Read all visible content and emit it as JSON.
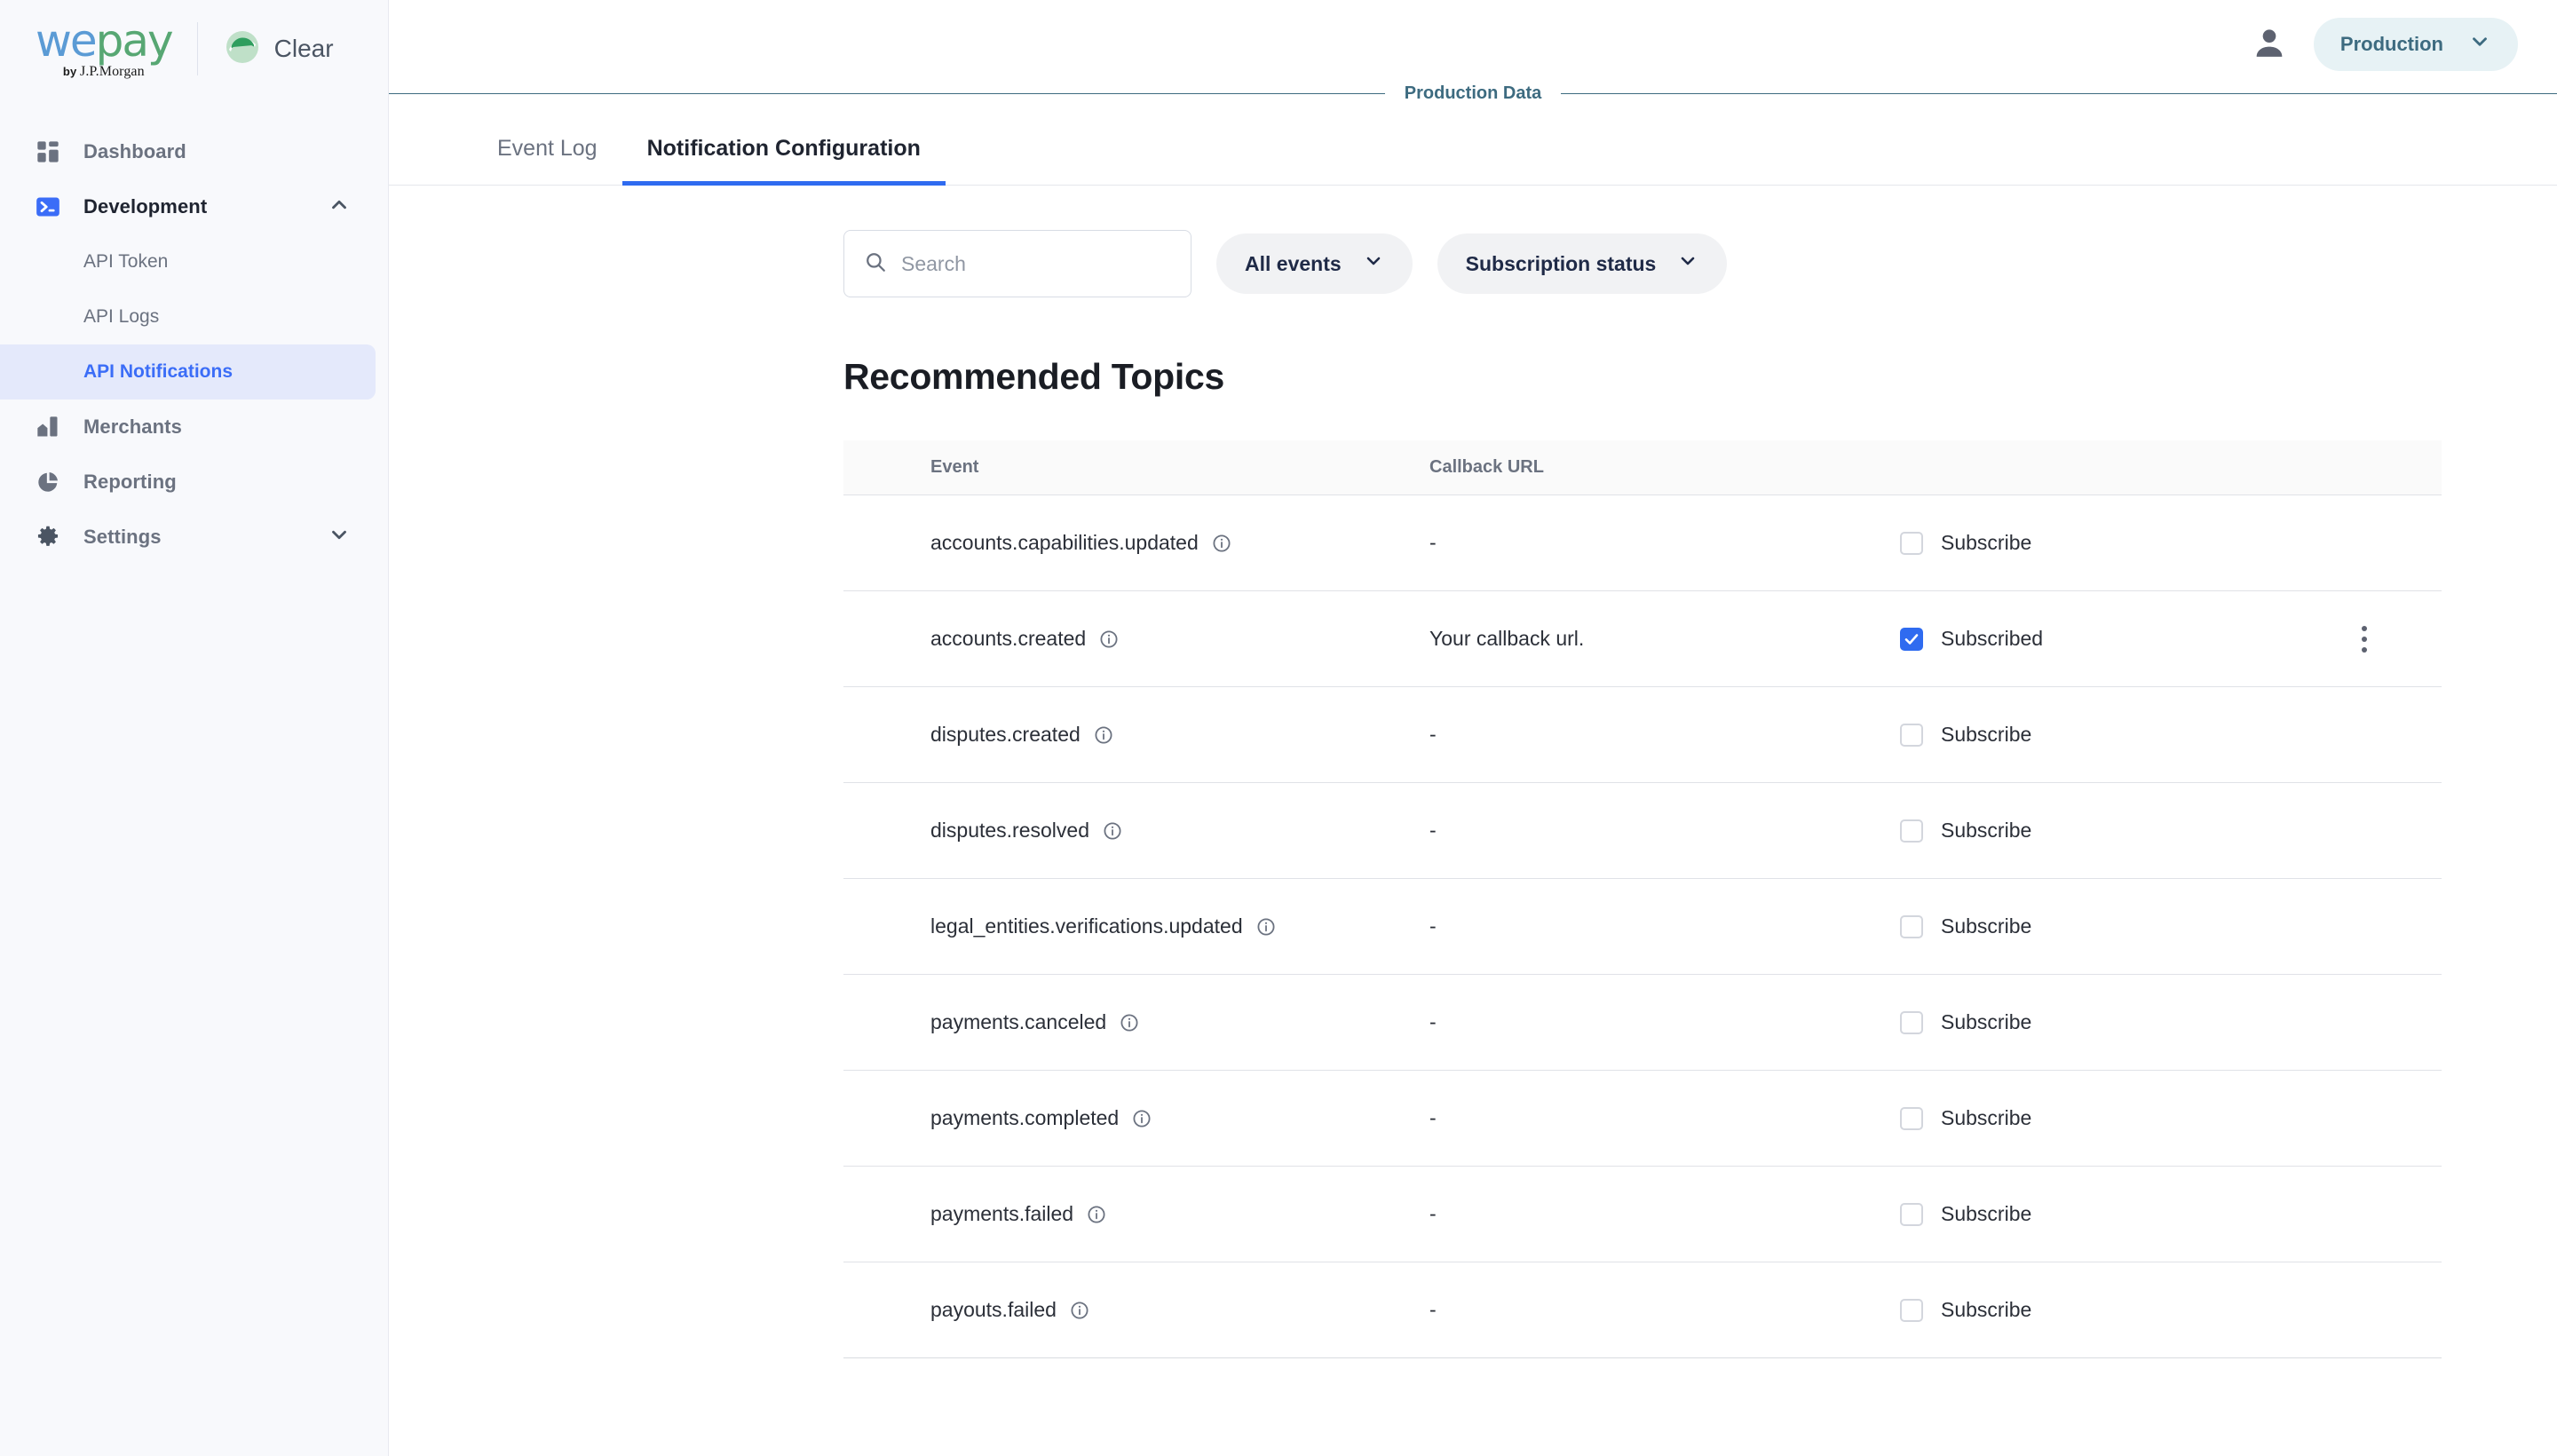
{
  "brand": {
    "logo_word_1": "we",
    "logo_word_2": "pay",
    "logo_by": "by ",
    "logo_parent": "J.P.Morgan",
    "client_name": "Clear",
    "client_logo_icon": "clear-leaf-icon"
  },
  "sidebar": {
    "items": [
      {
        "label": "Dashboard",
        "icon": "dashboard-grid-icon",
        "type": "item",
        "active": false
      },
      {
        "label": "Development",
        "icon": "terminal-icon",
        "type": "parent",
        "active": true,
        "chevron": "chevron-up-icon"
      },
      {
        "label": "API Token",
        "type": "sub",
        "selected": false
      },
      {
        "label": "API Logs",
        "type": "sub",
        "selected": false
      },
      {
        "label": "API Notifications",
        "type": "sub",
        "selected": true
      },
      {
        "label": "Merchants",
        "icon": "merchants-store-icon",
        "type": "item",
        "active": false
      },
      {
        "label": "Reporting",
        "icon": "pie-chart-icon",
        "type": "item",
        "active": false
      },
      {
        "label": "Settings",
        "icon": "gear-icon",
        "type": "parent",
        "active": false,
        "chevron": "chevron-down-icon"
      }
    ]
  },
  "topbar": {
    "account_icon": "user-avatar-icon",
    "environment": "Production",
    "environment_chevron": "chevron-down-icon",
    "banner_text": "Production Data"
  },
  "tabs": [
    {
      "label": "Event Log",
      "active": false
    },
    {
      "label": "Notification Configuration",
      "active": true
    }
  ],
  "filters": {
    "search_placeholder": "Search",
    "search_value": "",
    "search_icon": "search-icon",
    "event_filter_label": "All events",
    "status_filter_label": "Subscription status",
    "chevron_icon": "chevron-down-icon"
  },
  "main": {
    "section_title": "Recommended Topics",
    "columns": [
      "Event",
      "Callback URL"
    ],
    "rows": [
      {
        "event": "accounts.capabilities.updated",
        "callback_url": "-",
        "subscribed": false,
        "sub_label": "Subscribe",
        "menu": false
      },
      {
        "event": "accounts.created",
        "callback_url": "Your callback url.",
        "subscribed": true,
        "sub_label": "Subscribed",
        "menu": true
      },
      {
        "event": "disputes.created",
        "callback_url": "-",
        "subscribed": false,
        "sub_label": "Subscribe",
        "menu": false
      },
      {
        "event": "disputes.resolved",
        "callback_url": "-",
        "subscribed": false,
        "sub_label": "Subscribe",
        "menu": false
      },
      {
        "event": "legal_entities.verifications.updated",
        "callback_url": "-",
        "subscribed": false,
        "sub_label": "Subscribe",
        "menu": false
      },
      {
        "event": "payments.canceled",
        "callback_url": "-",
        "subscribed": false,
        "sub_label": "Subscribe",
        "menu": false
      },
      {
        "event": "payments.completed",
        "callback_url": "-",
        "subscribed": false,
        "sub_label": "Subscribe",
        "menu": false
      },
      {
        "event": "payments.failed",
        "callback_url": "-",
        "subscribed": false,
        "sub_label": "Subscribe",
        "menu": false
      },
      {
        "event": "payouts.failed",
        "callback_url": "-",
        "subscribed": false,
        "sub_label": "Subscribe",
        "menu": false
      }
    ],
    "info_icon": "info-circle-icon",
    "row_menu_icon": "more-vertical-icon"
  },
  "colors": {
    "accent_blue": "#2f6bf0",
    "sidebar_bg": "#f8f9fc",
    "selected_nav_bg": "#e4e9fb",
    "env_pill_bg": "#e7f2f5",
    "env_pill_text": "#3d6b80",
    "logo_blue": "#5b9bd5",
    "logo_green": "#57a773"
  }
}
